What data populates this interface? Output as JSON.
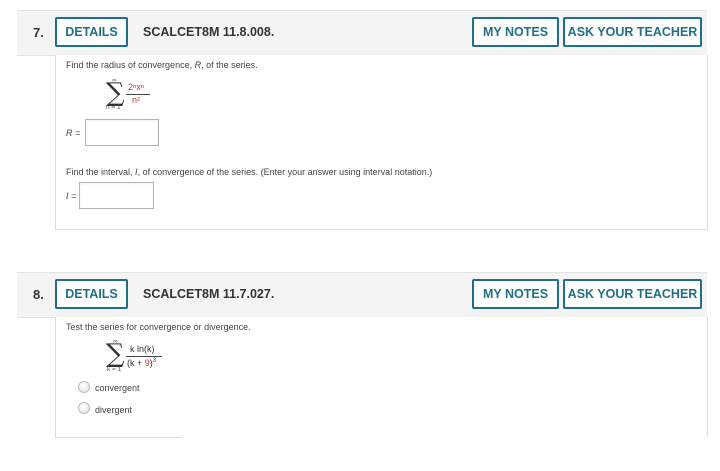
{
  "questions": [
    {
      "number": "7.",
      "details_label": "DETAILS",
      "code": "SCALCET8M 11.8.008.",
      "notes_label": "MY NOTES",
      "ask_label": "ASK YOUR TEACHER",
      "prompt_radius": "Find the radius of convergence, R, of the series.",
      "prompt_radius_pre": "Find the radius of convergence, ",
      "prompt_radius_var": "R",
      "prompt_radius_post": ", of the series.",
      "series": {
        "upper": "∞",
        "lower": "n = 1",
        "numerator": "2ⁿxⁿ",
        "denominator": "n²"
      },
      "r_label": "R =",
      "r_value": "",
      "prompt_interval_pre": "Find the interval, ",
      "prompt_interval_var": "I",
      "prompt_interval_post": ", of convergence of the series. (Enter your answer using interval notation.)",
      "i_label": "I =",
      "i_value": ""
    },
    {
      "number": "8.",
      "details_label": "DETAILS",
      "code": "SCALCET8M 11.7.027.",
      "notes_label": "MY NOTES",
      "ask_label": "ASK YOUR TEACHER",
      "prompt": "Test the series for convergence or divergence.",
      "series": {
        "upper": "∞",
        "lower": "k = 1",
        "numerator": "k ln(k)",
        "denominator_pre": "(k + ",
        "denominator_red": "9",
        "denominator_post": ")",
        "denominator_exp": "3"
      },
      "options": [
        "convergent",
        "divergent"
      ]
    }
  ]
}
